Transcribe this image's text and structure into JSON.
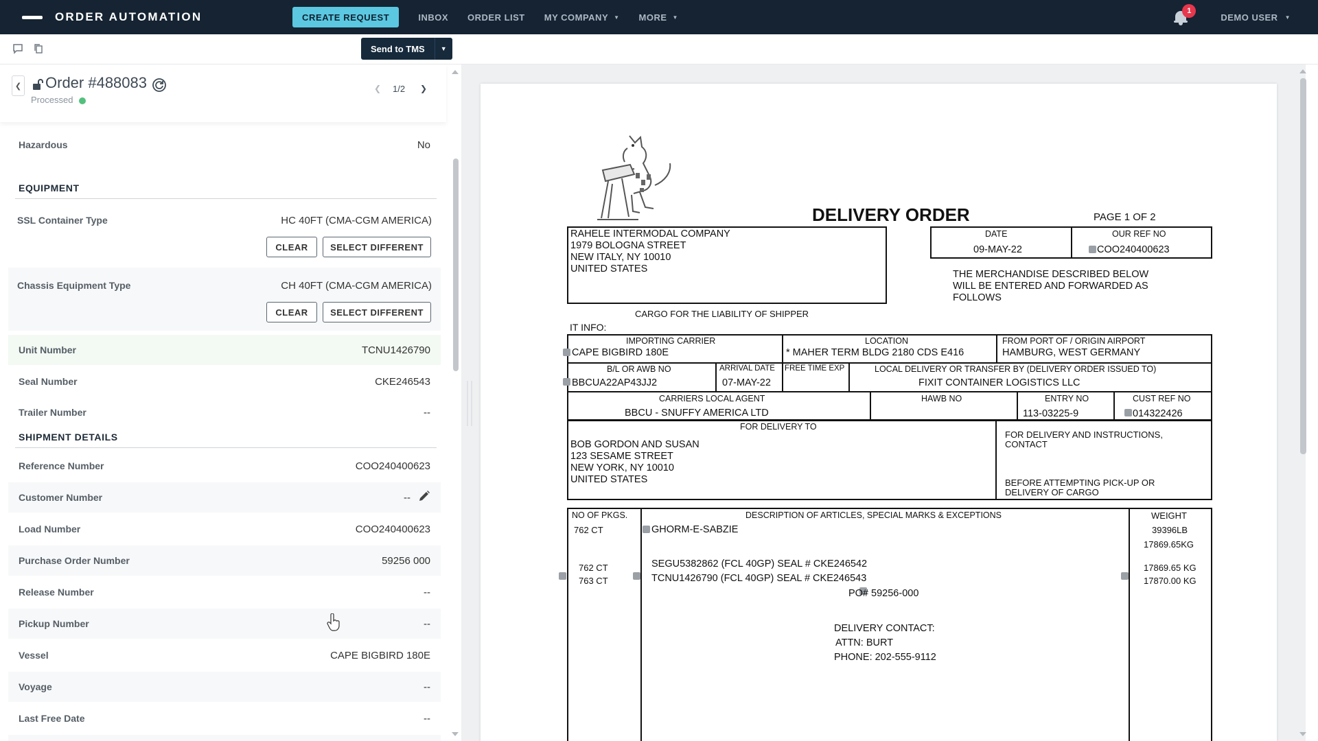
{
  "nav": {
    "brand": "ORDER AUTOMATION",
    "create_request": "CREATE REQUEST",
    "inbox": "INBOX",
    "order_list": "ORDER LIST",
    "my_company": "MY COMPANY",
    "more": "MORE",
    "notification_count": "1",
    "user": "DEMO USER"
  },
  "toolbar": {
    "send_to_tms": "Send to TMS"
  },
  "order": {
    "title": "Order #488083",
    "status": "Processed",
    "pager": "1/2"
  },
  "fields": {
    "hazardous": {
      "label": "Hazardous",
      "value": "No"
    },
    "equipment_title": "EQUIPMENT",
    "ssl_container": {
      "label": "SSL Container Type",
      "value": "HC 40FT (CMA-CGM AMERICA)"
    },
    "chassis": {
      "label": "Chassis Equipment Type",
      "value": "CH 40FT (CMA-CGM AMERICA)"
    },
    "clear_label": "CLEAR",
    "select_different_label": "SELECT DIFFERENT",
    "unit_number": {
      "label": "Unit Number",
      "value": "TCNU1426790"
    },
    "seal_number": {
      "label": "Seal Number",
      "value": "CKE246543"
    },
    "trailer_number": {
      "label": "Trailer Number",
      "value": "--"
    },
    "shipment_title": "SHIPMENT DETAILS",
    "reference_number": {
      "label": "Reference Number",
      "value": "COO240400623"
    },
    "customer_number": {
      "label": "Customer Number",
      "value": "--"
    },
    "load_number": {
      "label": "Load Number",
      "value": "COO240400623"
    },
    "purchase_order": {
      "label": "Purchase Order Number",
      "value": "59256 000"
    },
    "release_number": {
      "label": "Release Number",
      "value": "--"
    },
    "pickup_number": {
      "label": "Pickup Number",
      "value": "--"
    },
    "vessel": {
      "label": "Vessel",
      "value": "CAPE BIGBIRD 180E"
    },
    "voyage": {
      "label": "Voyage",
      "value": "--"
    },
    "last_free_date": {
      "label": "Last Free Date",
      "value": "--"
    }
  },
  "document": {
    "title": "DELIVERY ORDER",
    "page_of": "PAGE 1 OF 2",
    "company": [
      "RAHELE INTERMODAL COMPANY",
      "1979 BOLOGNA STREET",
      "NEW ITALY, NY 10010",
      "UNITED STATES"
    ],
    "date_label": "DATE",
    "date_value": "09-MAY-22",
    "our_ref_label": "OUR REF NO",
    "our_ref_value": "COO240400623",
    "merchandise_note": [
      "THE MERCHANDISE DESCRIBED BELOW",
      "WILL BE ENTERED AND FORWARDED AS",
      "FOLLOWS"
    ],
    "cargo_note": "CARGO FOR THE LIABILITY OF SHIPPER",
    "it_info": "IT INFO:",
    "importing_carrier_label": "IMPORTING CARRIER",
    "importing_carrier_value": "CAPE BIGBIRD 180E",
    "location_label": "LOCATION",
    "location_value": "* MAHER TERM BLDG 2180 CDS E416",
    "from_port_label": "FROM PORT OF / ORIGIN AIRPORT",
    "from_port_value": "HAMBURG, WEST GERMANY",
    "bl_label": "B/L OR AWB NO",
    "bl_value": "BBCUA22AP43JJ2",
    "arrival_label": "ARRIVAL DATE",
    "arrival_value": "07-MAY-22",
    "free_time_label": "FREE TIME EXP",
    "local_delivery_label": "LOCAL DELIVERY OR TRANSFER BY (DELIVERY ORDER ISSUED TO)",
    "local_delivery_value": "FIXIT CONTAINER LOGISTICS LLC",
    "agent_label": "CARRIERS LOCAL AGENT",
    "agent_value": "BBCU - SNUFFY AMERICA LTD",
    "hawb_label": "HAWB NO",
    "entry_label": "ENTRY NO",
    "entry_value": "113-03225-9",
    "cust_ref_label": "CUST REF NO",
    "cust_ref_value": "014322426",
    "delivery_to_label": "FOR DELIVERY TO",
    "delivery_to": [
      "BOB GORDON AND SUSAN",
      "123 SESAME STREET",
      "NEW YORK, NY 10010",
      "UNITED STATES"
    ],
    "instructions": [
      "FOR DELIVERY AND INSTRUCTIONS,",
      "CONTACT"
    ],
    "before_pickup": [
      "BEFORE ATTEMPTING PICK-UP OR",
      "DELIVERY OF CARGO"
    ],
    "pkgs_label": "NO OF PKGS.",
    "pkgs": [
      "762 CT",
      "762 CT",
      "763 CT"
    ],
    "desc_label": "DESCRIPTION OF ARTICLES, SPECIAL MARKS & EXCEPTIONS",
    "desc_item": "GHORM-E-SABZIE",
    "containers": [
      "SEGU5382862 (FCL 40GP) SEAL # CKE246542",
      "TCNU1426790 (FCL 40GP) SEAL # CKE246543"
    ],
    "po": "PO# 59256-000",
    "contact": [
      "DELIVERY CONTACT:",
      "ATTN: BURT",
      "PHONE: 202-555-9112"
    ],
    "weight_label": "WEIGHT",
    "weights": [
      "39396LB",
      "17869.65KG",
      "17869.65 KG",
      "17870.00 KG"
    ]
  }
}
